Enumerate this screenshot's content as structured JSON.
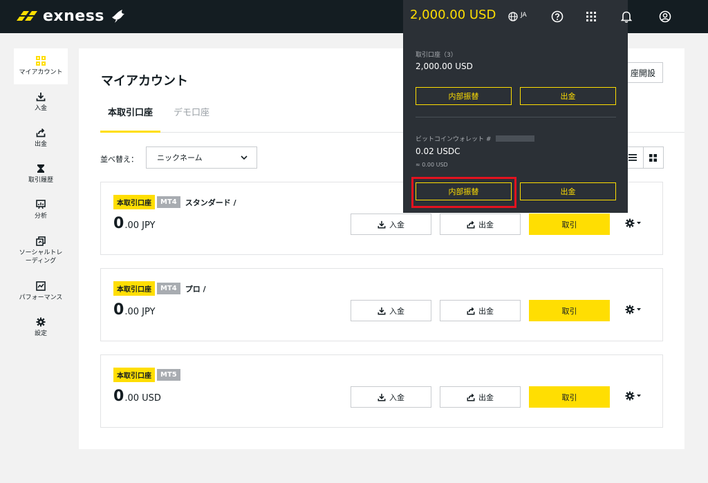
{
  "brand": {
    "name": "exness"
  },
  "header": {
    "balance": "2,000.00 USD",
    "language": "JA"
  },
  "sidebar": {
    "items": [
      {
        "label": "マイアカウント",
        "icon": "dashboard-icon",
        "active": true
      },
      {
        "label": "入金",
        "icon": "deposit-icon"
      },
      {
        "label": "出金",
        "icon": "withdraw-icon"
      },
      {
        "label": "取引履歴",
        "icon": "history-icon"
      },
      {
        "label": "分析",
        "icon": "analytics-icon"
      },
      {
        "label": "ソーシャルトレーディング",
        "label_lines": [
          "ソーシャルトレ",
          "ーディング"
        ],
        "icon": "social-trading-icon"
      },
      {
        "label": "パフォーマンス",
        "icon": "performance-icon"
      },
      {
        "label": "設定",
        "icon": "settings-icon"
      }
    ]
  },
  "main": {
    "title": "マイアカウント",
    "open_account_label": "座開設",
    "tabs": [
      {
        "label": "本取引口座",
        "active": true
      },
      {
        "label": "デモ口座",
        "active": false
      }
    ],
    "sort": {
      "label": "並べ替え：",
      "value": "ニックネーム"
    }
  },
  "accounts": [
    {
      "badge": "本取引口座",
      "platform": "MT4",
      "name": "スタンダード /",
      "balance_int": "0",
      "balance_rest": ".00 JPY",
      "deposit": "入金",
      "withdraw": "出金",
      "trade": "取引"
    },
    {
      "badge": "本取引口座",
      "platform": "MT4",
      "name": "プロ /",
      "balance_int": "0",
      "balance_rest": ".00 JPY",
      "deposit": "入金",
      "withdraw": "出金",
      "trade": "取引"
    },
    {
      "badge": "本取引口座",
      "platform": "MT5",
      "name": "",
      "balance_int": "0",
      "balance_rest": ".00 USD",
      "deposit": "入金",
      "withdraw": "出金",
      "trade": "取引"
    }
  ],
  "dropdown": {
    "trading": {
      "label": "取引口座（3）",
      "amount": "2,000.00 USD",
      "transfer": "内部振替",
      "withdraw": "出金"
    },
    "wallet": {
      "label": "ビットコインウォレット #",
      "amount": "0.02 USDC",
      "approx": "≈ 0.00 USD",
      "transfer": "内部振替",
      "withdraw": "出金"
    }
  },
  "colors": {
    "brand_yellow": "#ffde02",
    "topbar": "#141d22",
    "dropdown_bg": "#2b3036",
    "highlight_red": "#e4121f"
  }
}
